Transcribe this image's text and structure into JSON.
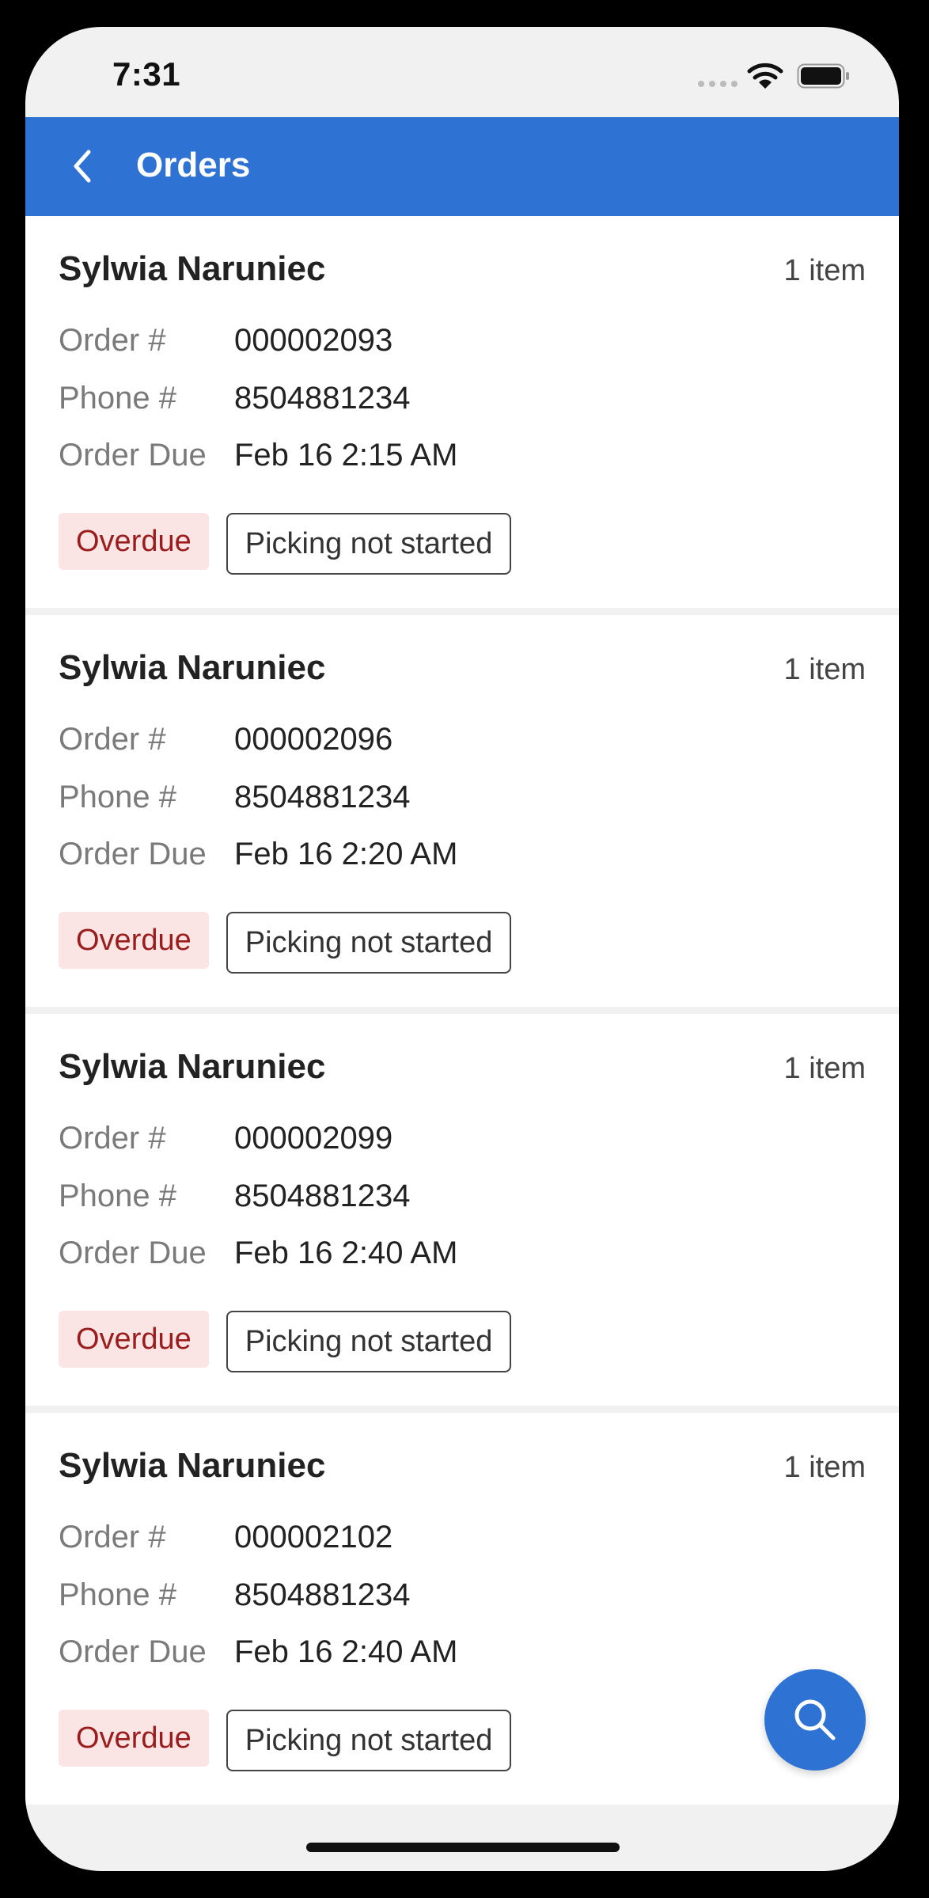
{
  "status_bar": {
    "time": "7:31"
  },
  "header": {
    "title": "Orders",
    "back_icon": "chevron-left-icon",
    "background": "#2e73d4"
  },
  "labels": {
    "order": "Order #",
    "phone": "Phone #",
    "due": "Order Due"
  },
  "orders": [
    {
      "customer": "Sylwia Naruniec",
      "item_count": "1 item",
      "order_number": "000002093",
      "phone": "8504881234",
      "due": "Feb 16 2:15 AM",
      "status_badge": "Overdue",
      "picking_status": "Picking not started"
    },
    {
      "customer": "Sylwia Naruniec",
      "item_count": "1 item",
      "order_number": "000002096",
      "phone": "8504881234",
      "due": "Feb 16 2:20 AM",
      "status_badge": "Overdue",
      "picking_status": "Picking not started"
    },
    {
      "customer": "Sylwia Naruniec",
      "item_count": "1 item",
      "order_number": "000002099",
      "phone": "8504881234",
      "due": "Feb 16 2:40 AM",
      "status_badge": "Overdue",
      "picking_status": "Picking not started"
    },
    {
      "customer": "Sylwia Naruniec",
      "item_count": "1 item",
      "order_number": "000002102",
      "phone": "8504881234",
      "due": "Feb 16 2:40 AM",
      "status_badge": "Overdue",
      "picking_status": "Picking not started"
    }
  ],
  "fab": {
    "icon": "search-icon"
  },
  "colors": {
    "accent": "#2e73d4",
    "overdue_bg": "#fbe4e4",
    "overdue_text": "#9b1c1c"
  }
}
